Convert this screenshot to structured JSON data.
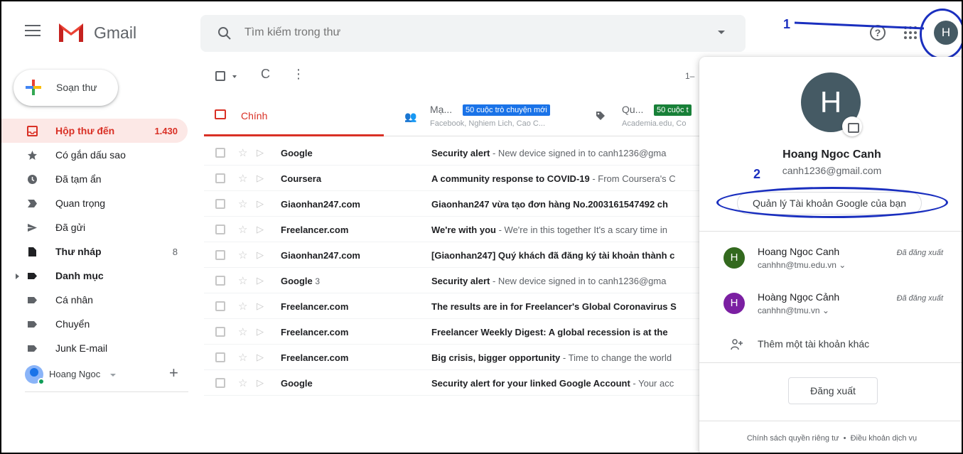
{
  "header": {
    "app_name": "Gmail",
    "search_placeholder": "Tìm kiếm trong thư",
    "avatar_letter": "H",
    "help_glyph": "?"
  },
  "annotations": {
    "step1": "1",
    "step2": "2"
  },
  "sidebar": {
    "compose_label": "Soạn thư",
    "items": [
      {
        "label": "Hộp thư đến",
        "count": "1.430",
        "icon": "inbox-icon"
      },
      {
        "label": "Có gắn dấu sao",
        "count": "",
        "icon": "star-icon"
      },
      {
        "label": "Đã tạm ẩn",
        "count": "",
        "icon": "clock-icon"
      },
      {
        "label": "Quan trọng",
        "count": "",
        "icon": "important-icon"
      },
      {
        "label": "Đã gửi",
        "count": "",
        "icon": "send-icon"
      },
      {
        "label": "Thư nháp",
        "count": "8",
        "icon": "draft-icon"
      },
      {
        "label": "Danh mục",
        "count": "",
        "icon": "label-icon"
      },
      {
        "label": "Cá nhân",
        "count": "",
        "icon": "label-icon"
      },
      {
        "label": "Chuyển",
        "count": "",
        "icon": "label-icon"
      },
      {
        "label": "Junk E-mail",
        "count": "",
        "icon": "label-icon"
      }
    ],
    "user_name": "Hoang Ngoc"
  },
  "toolbar": {
    "refresh_glyph": "C",
    "more_glyph": "⋮",
    "range": "1–"
  },
  "tabs": {
    "main": "Chính",
    "social": {
      "title": "Mạ...",
      "badge": "50 cuộc trò chuyện mới",
      "sub": "Facebook, Nghiem Lich, Cao C..."
    },
    "promotions": {
      "title": "Qu...",
      "badge": "50 cuộc t",
      "sub": "Academia.edu, Co"
    }
  },
  "emails": [
    {
      "sender": "Google",
      "count": "",
      "subject": "Security alert",
      "snippet": " - New device signed in to canh1236@gma"
    },
    {
      "sender": "Coursera",
      "count": "",
      "subject": "A community response to COVID-19",
      "snippet": " - From Coursera's C"
    },
    {
      "sender": "Giaonhan247.com",
      "count": "",
      "subject": "Giaonhan247 vừa tạo đơn hàng No.2003161547492 ch",
      "snippet": ""
    },
    {
      "sender": "Freelancer.com",
      "count": "",
      "subject": "We're with you",
      "snippet": " - We're in this together It's a scary time in"
    },
    {
      "sender": "Giaonhan247.com",
      "count": "",
      "subject": "[Giaonhan247] Quý khách đã đăng ký tài khoản thành c",
      "snippet": ""
    },
    {
      "sender": "Google",
      "count": "3",
      "subject": "Security alert",
      "snippet": " - New device signed in to canh1236@gma"
    },
    {
      "sender": "Freelancer.com",
      "count": "",
      "subject": "The results are in for Freelancer's Global Coronavirus S",
      "snippet": ""
    },
    {
      "sender": "Freelancer.com",
      "count": "",
      "subject": "Freelancer Weekly Digest: A global recession is at the",
      "snippet": ""
    },
    {
      "sender": "Freelancer.com",
      "count": "",
      "subject": "Big crisis, bigger opportunity",
      "snippet": " - Time to change the world"
    },
    {
      "sender": "Google",
      "count": "",
      "subject": "Security alert for your linked Google Account",
      "snippet": " - Your acc"
    }
  ],
  "account_popup": {
    "avatar_letter": "H",
    "name": "Hoang Ngoc Canh",
    "email": "canh1236@gmail.com",
    "manage_button": "Quản lý Tài khoản Google của bạn",
    "accounts": [
      {
        "letter": "H",
        "name": "Hoang Ngoc Canh",
        "email": "canhhn@tmu.edu.vn",
        "status": "Đã đăng xuất",
        "color": "#33691e"
      },
      {
        "letter": "H",
        "name": "Hoàng Ngọc Cảnh",
        "email": "canhhn@tmu.vn",
        "status": "Đã đăng xuất",
        "color": "#7b1fa2"
      }
    ],
    "add_account": "Thêm một tài khoản khác",
    "signout": "Đăng xuất",
    "footer_privacy": "Chính sách quyền riêng tư",
    "footer_sep": "•",
    "footer_terms": "Điều khoản dịch vụ"
  },
  "colors": {
    "accent_red": "#d93025",
    "social_badge": "#1a73e8",
    "promo_badge": "#188038",
    "annotation": "#1a2fbf"
  }
}
